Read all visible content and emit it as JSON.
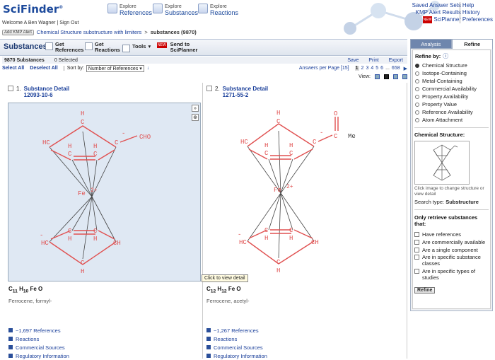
{
  "app": {
    "logo": "SciFinder",
    "logo_mark": "®"
  },
  "nav": [
    {
      "small": "Explore",
      "big": "References"
    },
    {
      "small": "Explore",
      "big": "Substances"
    },
    {
      "small": "Explore",
      "big": "Reactions"
    }
  ],
  "top_links": {
    "saved": "Saved Answer Sets",
    "kmp": "KMP Alert Results",
    "new": "NEW",
    "planner": "SciPlanner",
    "help": "Help",
    "history": "History",
    "prefs": "Preferences"
  },
  "welcome": "Welcome A Ben Wagner | Sign Out",
  "breadcrumb": {
    "kmp": "Add KMP Alert",
    "link": "Chemical Structure substructure with limiters",
    "sep": ">",
    "current": "substances (9870)"
  },
  "toolbar": {
    "title": "Substances",
    "get_refs": [
      "Get",
      "References"
    ],
    "get_reactions": [
      "Get",
      "Reactions"
    ],
    "tools": "Tools",
    "send": [
      "Send to",
      "SciPlanner"
    ],
    "new": "NEW"
  },
  "results": {
    "count": "9870 Substances",
    "selected": "0  Selected",
    "save": "Save",
    "print": "Print",
    "export": "Export"
  },
  "sortbar": {
    "select_all": "Select All",
    "deselect_all": "Deselect All",
    "sort_by": "Sort by:",
    "sort_value": "Number of References",
    "per_page": "Answers per Page [15]",
    "pages": [
      "1",
      "2",
      "3",
      "4",
      "5",
      "6",
      "...",
      "658"
    ]
  },
  "view_label": "View:",
  "cards": [
    {
      "num": "1.",
      "title": "Substance Detail",
      "cas": "12093-10-6",
      "formula": [
        "C",
        "11",
        "H",
        "10",
        "Fe O"
      ],
      "name": "Ferrocene, formyl-",
      "substituent": "CHO",
      "links": [
        "~1,697 References",
        "Reactions",
        "Commercial Sources",
        "Regulatory Information"
      ]
    },
    {
      "num": "2.",
      "title": "Substance Detail",
      "cas": "1271-55-2",
      "formula": [
        "C",
        "12",
        "H",
        "12",
        "Fe O"
      ],
      "name": "Ferrocene, acetyl-",
      "substituent": "Me",
      "links": [
        "~1,267 References",
        "Reactions",
        "Commercial Sources",
        "Regulatory Information"
      ]
    }
  ],
  "mol_labels": {
    "fe": "Fe",
    "charge": "2+",
    "ch": "CH",
    "hc": "HC",
    "c": "C",
    "h": "H",
    "minus": "-",
    "o": "O"
  },
  "tooltip": "Click to view detail",
  "panel": {
    "tab_analysis": "Analysis",
    "tab_refine": "Refine",
    "refine_by": "Refine by:",
    "options": [
      "Chemical Structure",
      "Isotope-Containing",
      "Metal-Containing",
      "Commercial Availability",
      "Property Availability",
      "Property Value",
      "Reference Availability",
      "Atom Attachment"
    ],
    "chem_struct": "Chemical Structure:",
    "click_img": "Click image to change structure or view detail",
    "search_type_label": "Search type:",
    "search_type": "Substructure",
    "only_retrieve": "Only retrieve substances that:",
    "checks": [
      "Have references",
      "Are commercially available",
      "Are a single component",
      "Are in specific substance classes",
      "Are in specific types of studies"
    ],
    "refine_btn": "Refine"
  },
  "colors": {
    "accent": "#1d4a9c",
    "molecule": "#e05050",
    "selected_card": "#dfe8f3"
  }
}
